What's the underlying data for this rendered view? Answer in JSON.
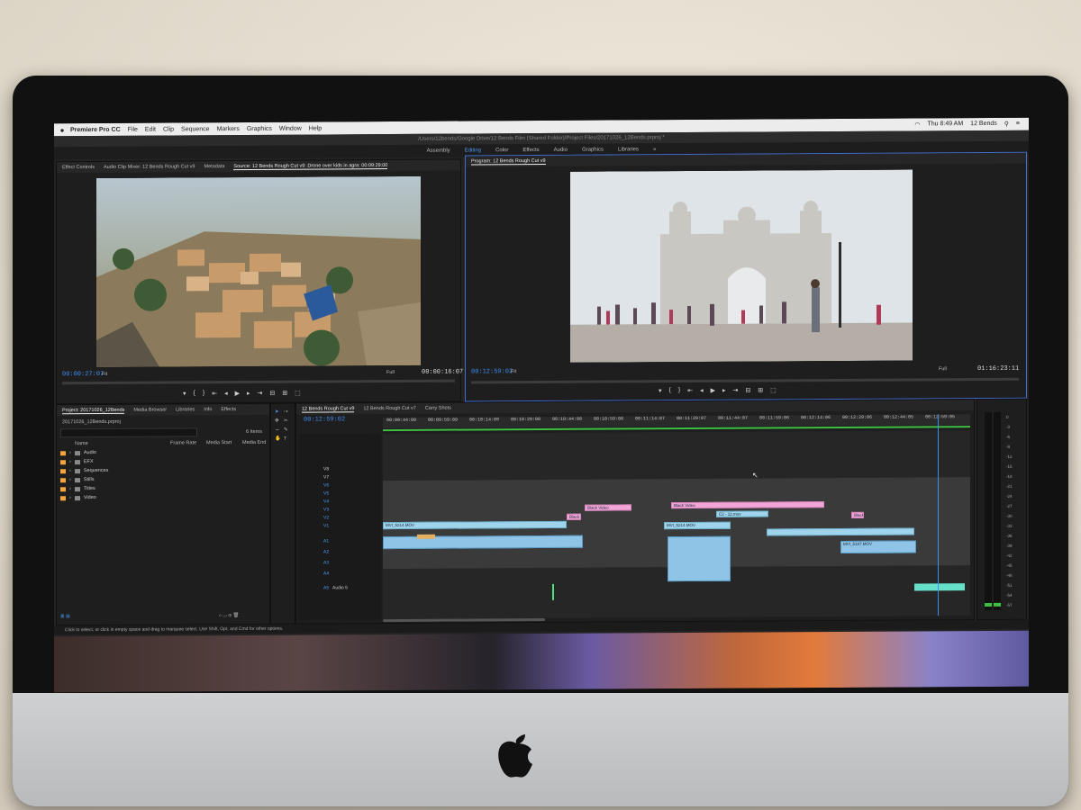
{
  "menubar": {
    "app_name": "Premiere Pro CC",
    "items": [
      "File",
      "Edit",
      "Clip",
      "Sequence",
      "Markers",
      "Graphics",
      "Window",
      "Help"
    ],
    "clock": "Thu 8:49 AM",
    "user": "12 Bends"
  },
  "titlebar": {
    "path": "/Users/12bends/Google Drive/12 Bends Film (Shared Folder)/Project Files/20171026_12Bends.prproj *"
  },
  "workspaces": {
    "items": [
      "Assembly",
      "Editing",
      "Color",
      "Effects",
      "Audio",
      "Graphics",
      "Libraries",
      "»"
    ],
    "active": "Editing"
  },
  "source_panel": {
    "tabs": [
      "Effect Controls",
      "Audio Clip Mixer: 12 Bends Rough Cut v9",
      "Metadata",
      "Source: 12 Bends Rough Cut v9: Drone over kids in agra: 00:09:29:00"
    ],
    "timecode_in": "00:00:27:07",
    "fit": "Fit",
    "quality": "Full",
    "timecode_dur": "00:00:16:07"
  },
  "program_panel": {
    "title": "Program: 12 Bends Rough Cut v9",
    "timecode": "00:12:59:02",
    "fit": "Fit",
    "quality": "Full",
    "duration": "01:16:23:11"
  },
  "project_panel": {
    "tabs": [
      "Project: 20171026_12Bends",
      "Media Browser",
      "Libraries",
      "Info",
      "Effects"
    ],
    "file": "20171026_12Bends.prproj",
    "count": "6 Items",
    "columns": [
      "Name",
      "Frame Rate",
      "Media Start",
      "Media End"
    ],
    "items": [
      "Audio",
      "EFX",
      "Sequences",
      "Stills",
      "Titles",
      "Video"
    ]
  },
  "timeline": {
    "tabs": [
      "12 Bends Rough Cut v9",
      "12 Bends Rough Cut v7",
      "Carry Shots"
    ],
    "timecode": "00:12:59:02",
    "ruler": [
      "00:09:44:09",
      "00:09:59:09",
      "00:10:14:09",
      "00:10:29:08",
      "00:10:44:08",
      "00:10:59:08",
      "00:11:14:07",
      "00:11:29:07",
      "00:11:44:07",
      "00:11:59:06",
      "00:12:14:06",
      "00:12:29:06",
      "00:12:44:05",
      "00:12:59:05"
    ],
    "video_tracks": [
      "V8",
      "V7",
      "V6",
      "V5",
      "V4",
      "V3",
      "V2",
      "V1"
    ],
    "audio_tracks": [
      "A1",
      "A2",
      "A3",
      "A4",
      "A5"
    ],
    "audio5_name": "Audio 5",
    "clips": {
      "c1": "MVI_5214.MOV",
      "c2": "MVI_5214.MOV",
      "c3": "Black Video",
      "c4": "Black Video",
      "c5": "Black Video",
      "c6": "Black Video",
      "c7": "C2 - 12.mov",
      "c8": "MVI_5187.MOV"
    },
    "meter_ticks": [
      "0",
      "-3",
      "-6",
      "-9",
      "-12",
      "-15",
      "-18",
      "-21",
      "-24",
      "-27",
      "-30",
      "-33",
      "-36",
      "-39",
      "-42",
      "-45",
      "-48",
      "-51",
      "-54",
      "-57"
    ]
  },
  "statusbar": {
    "text": "Click to select, or click in empty space and drag to marquee select. Use Shift, Opt, and Cmd for other options."
  },
  "colors": {
    "accent": "#3f8cf3",
    "clip_video": "#9fd4ec",
    "clip_black": "#f2a6d8",
    "folder": "#f3a43a"
  }
}
